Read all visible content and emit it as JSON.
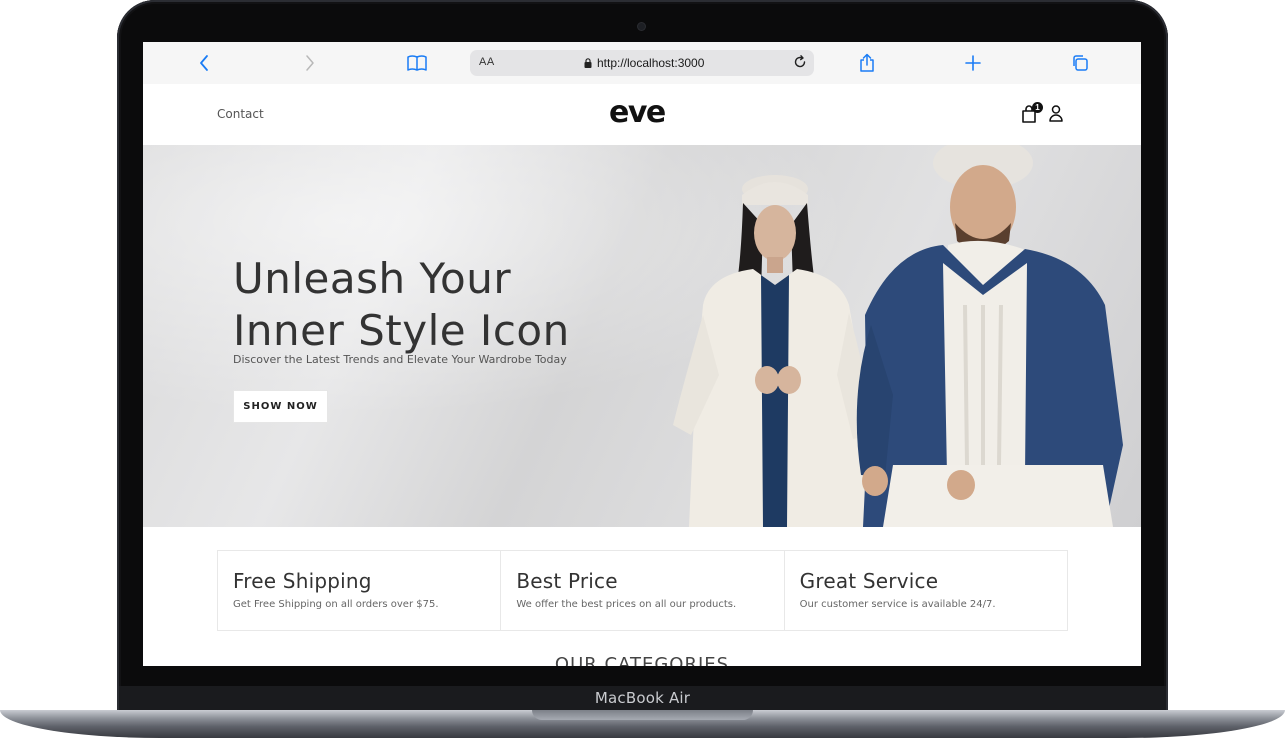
{
  "device": {
    "label": "MacBook Air"
  },
  "browser": {
    "text_size_label": "AA",
    "url": "http://localhost:3000"
  },
  "site": {
    "nav": {
      "contact_label": "Contact"
    },
    "logo": "eve",
    "cart": {
      "count": "1"
    }
  },
  "hero": {
    "title_line1": "Unleash Your",
    "title_line2": "Inner Style Icon",
    "subtitle": "Discover the Latest Trends and Elevate Your Wardrobe Today",
    "cta_label": "SHOW NOW"
  },
  "features": [
    {
      "title": "Free Shipping",
      "description": "Get Free Shipping on all orders over $75."
    },
    {
      "title": "Best Price",
      "description": "We offer the best prices on all our products."
    },
    {
      "title": "Great Service",
      "description": "Our customer service is available 24/7."
    }
  ],
  "categories": {
    "heading": "OUR CATEGORIES"
  },
  "colors": {
    "browser_accent": "#1a7cf5",
    "text_dark": "#333333",
    "hero_background": "#dcdcdd",
    "jacket_blue": "#2d4a7a"
  }
}
